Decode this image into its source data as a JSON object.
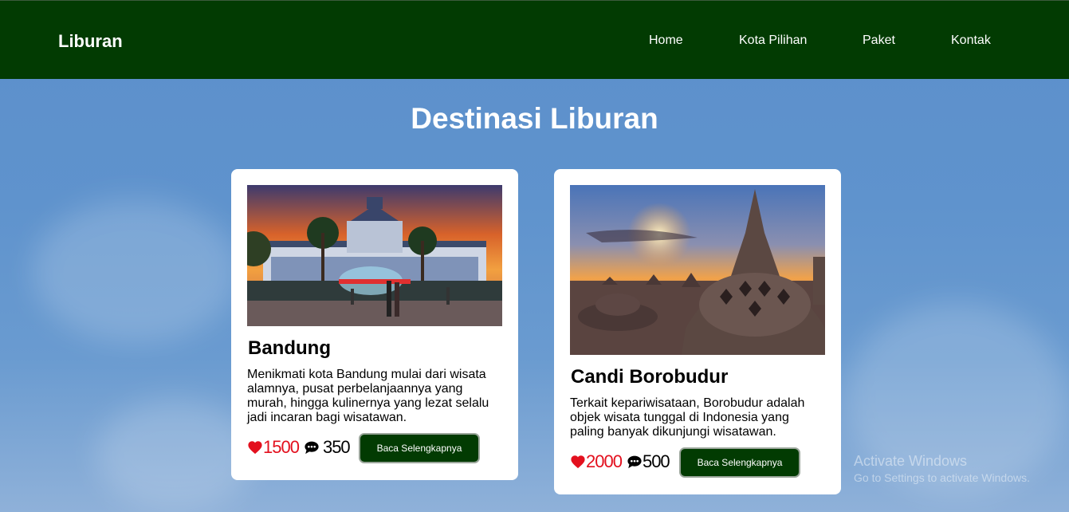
{
  "header": {
    "brand": "Liburan",
    "nav": [
      "Home",
      "Kota Pilihan",
      "Paket",
      "Kontak"
    ]
  },
  "main": {
    "title": "Destinasi Liburan",
    "cards": [
      {
        "title": "Bandung",
        "description": "Menikmati kota Bandung mulai dari wisata alamnya, pusat perbelanjaannya yang murah, hingga kulinernya yang lezat selalu jadi incaran bagi wisatawan.",
        "likes": "1500",
        "comments": "350",
        "button": "Baca Selengkapnya"
      },
      {
        "title": "Candi Borobudur",
        "description": "Terkait kepariwisataan, Borobudur adalah objek wisata tunggal di Indonesia yang paling banyak dikunjungi wisatawan.",
        "likes": "2000",
        "comments": "500",
        "button": "Baca Selengkapnya"
      }
    ]
  },
  "watermark": {
    "line1": "Activate Windows",
    "line2": "Go to Settings to activate Windows."
  },
  "colors": {
    "header_bg": "#023b02",
    "button_bg": "#023b02",
    "like_red": "#e3101e",
    "sky": "#5f93cd"
  },
  "icons": {
    "like": "heart-icon",
    "comment": "comment-icon"
  }
}
